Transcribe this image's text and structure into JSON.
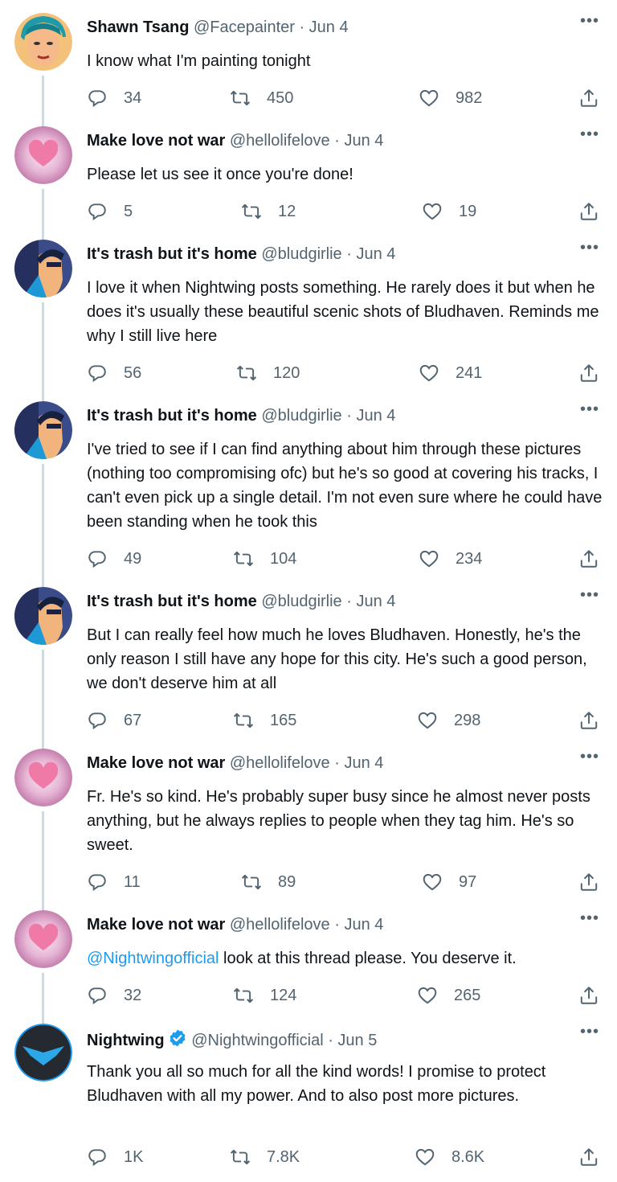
{
  "colors": {
    "link": "#1d9bf0",
    "muted": "#536471",
    "text": "#0f1419",
    "thread_line": "#cfd9de",
    "verified": "#1d9bf0"
  },
  "tweets": [
    {
      "name": "Shawn Tsang",
      "handle": "@Facepainter",
      "date": "· Jun 4",
      "avatar": "painter-avatar",
      "text": "I know what I'm painting tonight",
      "replies": "34",
      "retweets": "450",
      "likes": "982"
    },
    {
      "name": "Make love not war",
      "handle": "@hellolifelove",
      "date": "· Jun 4",
      "avatar": "heart-avatar",
      "text": "Please let us see it once you're done!",
      "replies": "5",
      "retweets": "12",
      "likes": "19"
    },
    {
      "name": "It's trash but it's home",
      "handle": "@bludgirlie",
      "date": "· Jun 4",
      "avatar": "nightwing-art-avatar",
      "text": "I love it when Nightwing posts something. He rarely does it but when he does it's usually these beautiful scenic shots of Bludhaven. Reminds me why I still live here",
      "replies": "56",
      "retweets": "120",
      "likes": "241"
    },
    {
      "name": "It's trash but it's home",
      "handle": "@bludgirlie",
      "date": "· Jun 4",
      "avatar": "nightwing-art-avatar",
      "text": "I've tried to see if I can find anything about him through these pictures (nothing too compromising ofc) but he's so good at covering his tracks, I can't even pick up a single detail. I'm not even sure where he could have been standing when he took this",
      "replies": "49",
      "retweets": "104",
      "likes": "234"
    },
    {
      "name": "It's trash but it's home",
      "handle": "@bludgirlie",
      "date": "· Jun 4",
      "avatar": "nightwing-art-avatar",
      "text": "But I can really feel how much he loves Bludhaven. Honestly, he's the only reason I still have any hope for this city. He's such a good person, we don't deserve him at all",
      "replies": "67",
      "retweets": "165",
      "likes": "298"
    },
    {
      "name": "Make love not war",
      "handle": "@hellolifelove",
      "date": "· Jun 4",
      "avatar": "heart-avatar",
      "text": "Fr. He's so kind. He's probably super busy since he almost never posts anything, but he always replies to people when they tag him. He's so sweet.",
      "replies": "11",
      "retweets": "89",
      "likes": "97"
    },
    {
      "name": "Make love not war",
      "handle": "@hellolifelove",
      "date": "· Jun 4",
      "avatar": "heart-avatar",
      "mention": "@Nightwingofficial",
      "text": " look at this thread please. You deserve it.",
      "replies": "32",
      "retweets": "124",
      "likes": "265"
    },
    {
      "name": "Nightwing",
      "handle": "@Nightwingofficial",
      "date": "· Jun 5",
      "avatar": "nightwing-logo-avatar",
      "verified": true,
      "text": "Thank you all so much for all the kind words! I promise to protect Bludhaven with all my power. And to also post more pictures.",
      "replies": "1K",
      "retweets": "7.8K",
      "likes": "8.6K"
    }
  ],
  "more_label": "•••"
}
